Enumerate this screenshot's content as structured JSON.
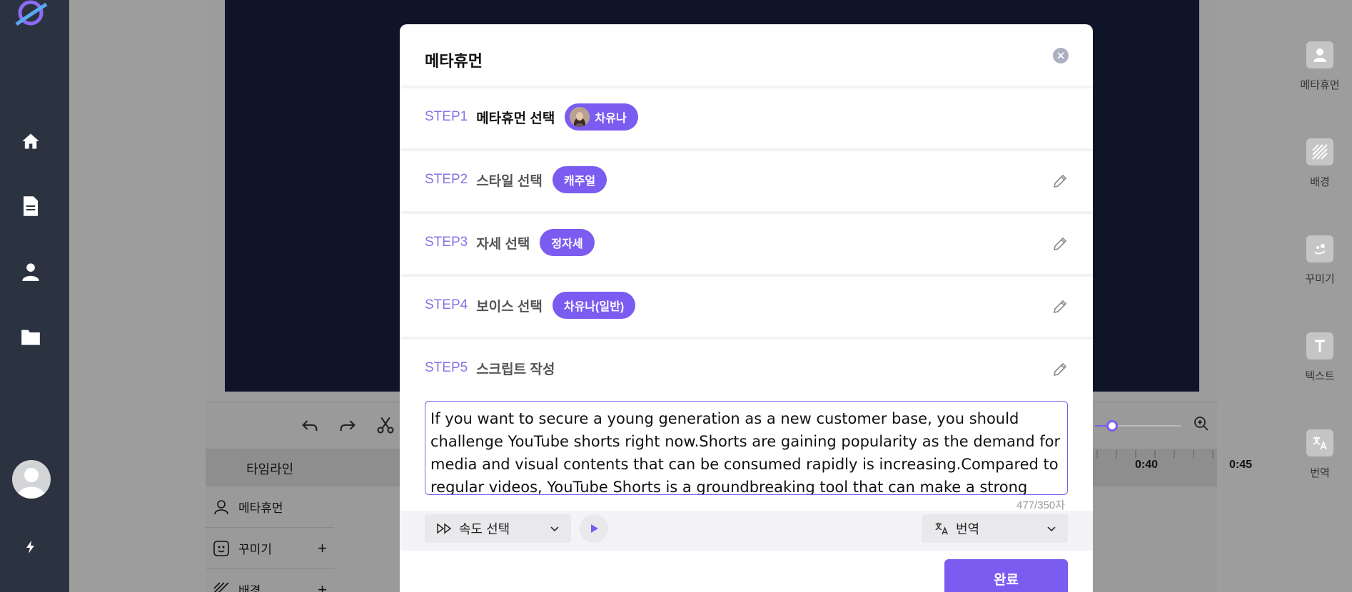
{
  "modal": {
    "title": "메타휴먼",
    "steps": [
      {
        "num": "STEP1",
        "title": "메타휴먼 선택",
        "chip": "차유나"
      },
      {
        "num": "STEP2",
        "title": "스타일 선택",
        "chip": "캐주얼"
      },
      {
        "num": "STEP3",
        "title": "자세 선택",
        "chip": "정자세"
      },
      {
        "num": "STEP4",
        "title": "보이스 선택",
        "chip": "차유나(일반)"
      },
      {
        "num": "STEP5",
        "title": "스크립트 작성"
      }
    ],
    "script_text": "If you want to secure a young generation as a new customer base, you should challenge YouTube shorts right now.Shorts are gaining popularity as the demand for media and visual contents that can be consumed rapidly is increasing.Compared to regular videos, YouTube Shorts is a groundbreaking tool that can make a strong impression while",
    "char_count": "477/350자",
    "speed_label": "속도 선택",
    "translate_label": "번역",
    "done_label": "완료"
  },
  "timeline": {
    "label": "타임라인",
    "ticks": [
      "0:40",
      "0:45"
    ],
    "zoom_level": 0.2,
    "tracks": [
      "메타휴먼",
      "꾸미기",
      "배경"
    ]
  },
  "right_rail": {
    "items": [
      "메타휴먼",
      "배경",
      "꾸미기",
      "텍스트",
      "번역"
    ]
  },
  "colors": {
    "accent": "#7b5cf0",
    "rail": "#2c3340",
    "stage": "#0f1428"
  }
}
